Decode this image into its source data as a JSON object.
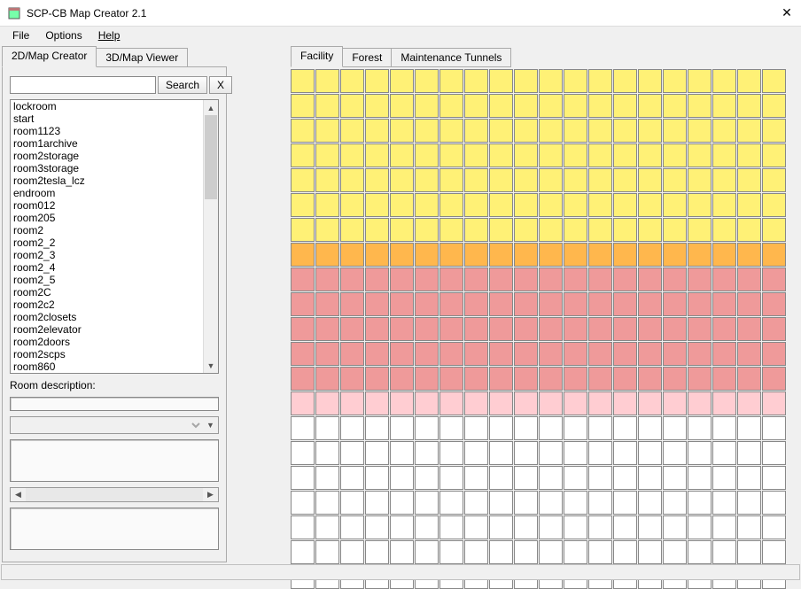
{
  "window": {
    "title": "SCP-CB Map Creator 2.1",
    "close_glyph": "✕"
  },
  "menu": {
    "file": "File",
    "options": "Options",
    "help": "Help"
  },
  "leftTabs": {
    "creator": "2D/Map Creator",
    "viewer": "3D/Map Viewer"
  },
  "search": {
    "placeholder": "",
    "button": "Search",
    "clear": "X"
  },
  "rooms": [
    "lockroom",
    "start",
    "room1123",
    "room1archive",
    "room2storage",
    "room3storage",
    "room2tesla_lcz",
    "endroom",
    "room012",
    "room205",
    "room2",
    "room2_2",
    "room2_3",
    "room2_4",
    "room2_5",
    "room2C",
    "room2c2",
    "room2closets",
    "room2elevator",
    "room2doors",
    "room2scps",
    "room860"
  ],
  "desc_label": "Room description:",
  "rightTabs": {
    "facility": "Facility",
    "forest": "Forest",
    "tunnels": "Maintenance Tunnels"
  },
  "grid": {
    "cols": 20,
    "rows": 21,
    "rowColors": [
      "#fff176",
      "#fff176",
      "#fff176",
      "#fff176",
      "#fff176",
      "#fff176",
      "#fff176",
      "#ffb74d",
      "#ef9a9a",
      "#ef9a9a",
      "#ef9a9a",
      "#ef9a9a",
      "#ef9a9a",
      "#ffcdd2",
      "#ffffff",
      "#ffffff",
      "#ffffff",
      "#ffffff",
      "#ffffff",
      "#ffffff",
      "#ffffff"
    ]
  }
}
